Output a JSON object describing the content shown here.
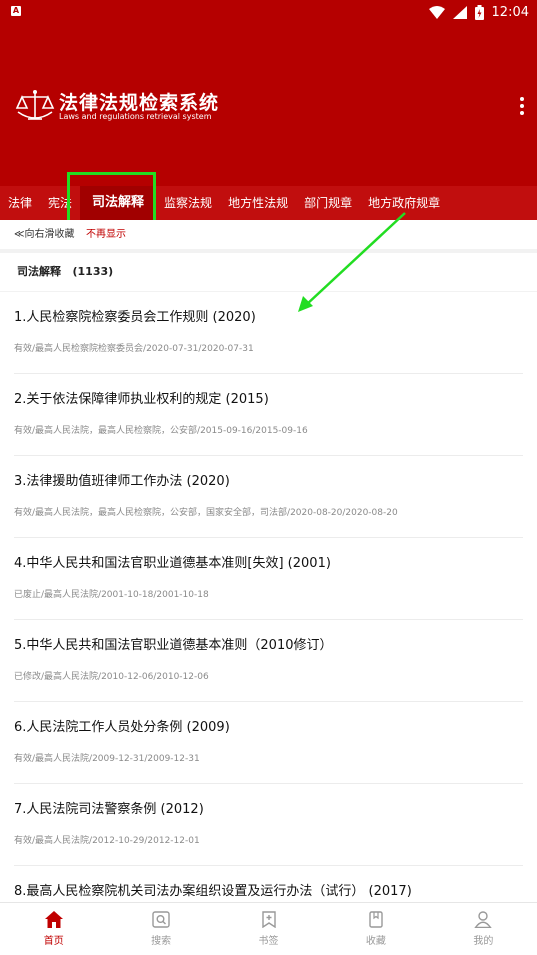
{
  "statusbar": {
    "badge": "A",
    "time": "12:04"
  },
  "header": {
    "title": "法律法规检索系统",
    "subtitle": "Laws and regulations retrieval system"
  },
  "tabs": [
    {
      "label": "法律"
    },
    {
      "label": "宪法"
    },
    {
      "label": "司法解释",
      "active": true
    },
    {
      "label": "监察法规"
    },
    {
      "label": "地方性法规"
    },
    {
      "label": "部门规章"
    },
    {
      "label": "地方政府规章"
    }
  ],
  "hint": {
    "swipe": "≪向右滑收藏",
    "dismiss": "不再显示"
  },
  "section": {
    "title": "司法解释",
    "count": "(1133)"
  },
  "items": [
    {
      "title": "1.人民检察院检察委员会工作规则 (2020)",
      "meta": "有效/最高人民检察院检察委员会/2020-07-31/2020-07-31"
    },
    {
      "title": "2.关于依法保障律师执业权利的规定 (2015)",
      "meta": "有效/最高人民法院，最高人民检察院，公安部/2015-09-16/2015-09-16"
    },
    {
      "title": "3.法律援助值班律师工作办法 (2020)",
      "meta": "有效/最高人民法院，最高人民检察院，公安部，国家安全部，司法部/2020-08-20/2020-08-20"
    },
    {
      "title": "4.中华人民共和国法官职业道德基本准则[失效] (2001)",
      "meta": "已废止/最高人民法院/2001-10-18/2001-10-18"
    },
    {
      "title": "5.中华人民共和国法官职业道德基本准则（2010修订）",
      "meta": "已修改/最高人民法院/2010-12-06/2010-12-06"
    },
    {
      "title": "6.人民法院工作人员处分条例 (2009)",
      "meta": "有效/最高人民法院/2009-12-31/2009-12-31"
    },
    {
      "title": "7.人民法院司法警察条例 (2012)",
      "meta": "有效/最高人民法院/2012-10-29/2012-12-01"
    },
    {
      "title": "8.最高人民检察院机关司法办案组织设置及运行办法（试行） (2017)",
      "meta": ""
    }
  ],
  "bottom_nav": [
    {
      "label": "首页",
      "icon": "home-icon",
      "active": true
    },
    {
      "label": "搜索",
      "icon": "search-icon"
    },
    {
      "label": "书签",
      "icon": "bookmark-icon"
    },
    {
      "label": "收藏",
      "icon": "favorites-icon"
    },
    {
      "label": "我的",
      "icon": "user-icon"
    }
  ],
  "colors": {
    "brand": "#b50000",
    "tab_bar": "#c10e0e",
    "annotation": "#22dd22"
  }
}
